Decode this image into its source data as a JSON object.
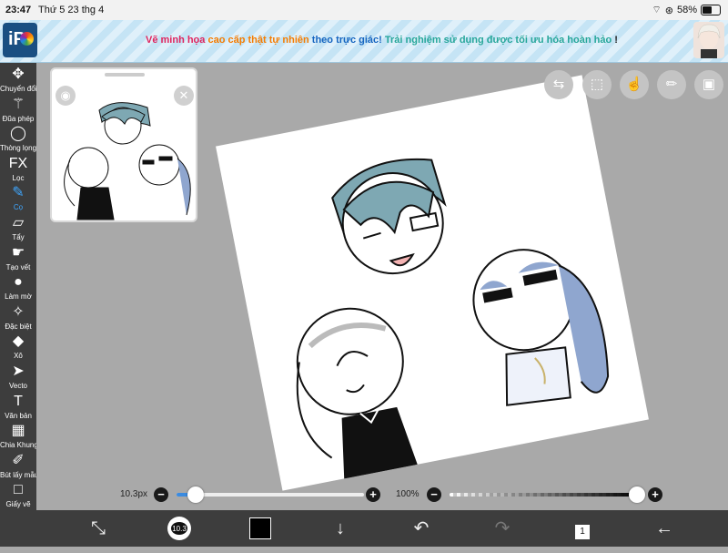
{
  "status": {
    "time": "23:47",
    "date": "Thứ 5 23 thg 4",
    "battery": "58%"
  },
  "banner": {
    "logo": "iP",
    "ad_parts": [
      {
        "text": "Vẽ minh họa ",
        "color": "#e0245e"
      },
      {
        "text": "cao cấp thật tự nhiên",
        "color": "#f57c00"
      },
      {
        "text": " theo trực giác! ",
        "color": "#1565c0"
      },
      {
        "text": "Trải nghiệm sử dụng được tối ưu hóa hoàn hảo",
        "color": "#26a69a"
      },
      {
        "text": " !",
        "color": "#222222"
      }
    ]
  },
  "tools": [
    {
      "label": "Chuyển đổi",
      "icon": "move-arrows-icon",
      "glyph": "✥"
    },
    {
      "label": "Đũa phép",
      "icon": "magic-wand-icon",
      "glyph": "⚚"
    },
    {
      "label": "Thòng lọng",
      "icon": "lasso-icon",
      "glyph": "◯"
    },
    {
      "label": "Lọc",
      "icon": "filter-fx-icon",
      "glyph": "FX"
    },
    {
      "label": "Cọ",
      "icon": "brush-icon",
      "glyph": "✎",
      "active": true
    },
    {
      "label": "Tẩy",
      "icon": "eraser-icon",
      "glyph": "▱"
    },
    {
      "label": "Tạo vết",
      "icon": "smudge-icon",
      "glyph": "☛"
    },
    {
      "label": "Làm mờ",
      "icon": "blur-drop-icon",
      "glyph": "●"
    },
    {
      "label": "Đặc biệt",
      "icon": "special-wand-icon",
      "glyph": "✧"
    },
    {
      "label": "Xô",
      "icon": "bucket-icon",
      "glyph": "◆"
    },
    {
      "label": "Vecto",
      "icon": "cursor-icon",
      "glyph": "➤"
    },
    {
      "label": "Văn bản",
      "icon": "text-icon",
      "glyph": "T"
    },
    {
      "label": "Chia Khung",
      "icon": "frame-divider-icon",
      "glyph": "▦"
    },
    {
      "label": "Bút lấy mẫu màu",
      "icon": "eyedropper-icon",
      "glyph": "✐"
    },
    {
      "label": "Giấy vẽ",
      "icon": "canvas-icon",
      "glyph": "□"
    }
  ],
  "brush": {
    "size_label": "10.3px",
    "size_fraction": 0.1,
    "opacity_label": "100%",
    "opacity_fraction": 1.0
  },
  "brush_preview_label": "10.3",
  "layer_count": "1",
  "colors": {
    "toolbar": "#3d3d3d",
    "accent": "#3fa7ff",
    "primary": "#000000",
    "hair_teal": "#7ea8b3",
    "hair_blue": "#8fa6cf"
  }
}
